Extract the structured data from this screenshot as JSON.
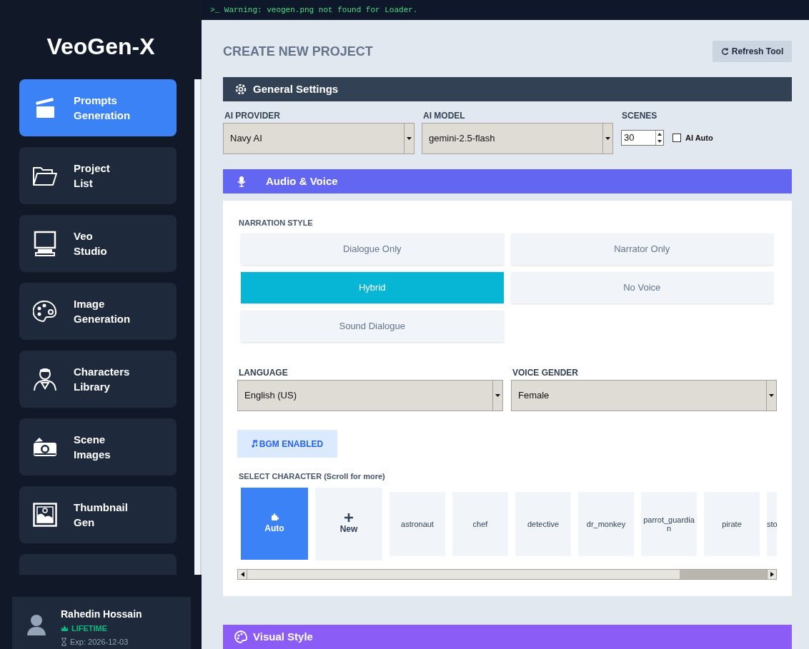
{
  "console": {
    "prompt": ">_",
    "message": "Warning: veogen.png not found for Loader."
  },
  "sidebar": {
    "title": "VeoGen-X",
    "items": [
      {
        "kind": "clapper",
        "label": "Prompts Generation",
        "selected": true
      },
      {
        "kind": "folder",
        "label": "Project List",
        "selected": false
      },
      {
        "kind": "monitor",
        "label": "Veo Studio",
        "selected": false
      },
      {
        "kind": "palette",
        "label": "Image Generation",
        "selected": false
      },
      {
        "kind": "person",
        "label": "Characters Library",
        "selected": false
      },
      {
        "kind": "camera",
        "label": "Scene Images",
        "selected": false
      },
      {
        "kind": "image",
        "label": "Thumbnail Gen",
        "selected": false
      },
      {
        "kind": "partial",
        "selected": false
      }
    ]
  },
  "user": {
    "name": "Rahedin Hossain",
    "plan": "LIFETIME",
    "expiry": "Exp: 2026-12-03"
  },
  "page": {
    "title": "CREATE NEW PROJECT",
    "refresh_button": "Refresh Tool"
  },
  "general_settings": {
    "title": "General Settings",
    "provider": {
      "label": "AI PROVIDER",
      "value": "Navy AI"
    },
    "model": {
      "label": "AI MODEL",
      "value": "gemini-2.5-flash"
    },
    "scenes": {
      "label": "SCENES",
      "value": "30"
    },
    "ai_auto": {
      "label": "AI Auto",
      "checked": false
    }
  },
  "audio_voice": {
    "title": "Audio & Voice",
    "narration_label": "NARRATION STYLE",
    "narration_options": [
      {
        "label": "Dialogue Only",
        "selected": false
      },
      {
        "label": "Narrator Only",
        "selected": false
      },
      {
        "label": "Hybrid",
        "selected": true
      },
      {
        "label": "No Voice",
        "selected": false
      },
      {
        "label": "Sound Dialogue",
        "selected": false
      }
    ],
    "language": {
      "label": "LANGUAGE",
      "value": "English (US)"
    },
    "voice_gender": {
      "label": "VOICE GENDER",
      "value": "Female"
    },
    "bgm_button": "BGM ENABLED",
    "character_label": "SELECT CHARACTER (Scroll for more)",
    "characters": [
      {
        "kind": "auto",
        "label": "Auto",
        "selected": true
      },
      {
        "kind": "new",
        "label": "New",
        "selected": false
      },
      {
        "kind": "character",
        "label": "astronaut",
        "selected": false
      },
      {
        "kind": "character",
        "label": "chef",
        "selected": false
      },
      {
        "kind": "character",
        "label": "detective",
        "selected": false
      },
      {
        "kind": "character",
        "label": "dr_monkey",
        "selected": false
      },
      {
        "kind": "character",
        "label": "parrot_guardian",
        "selected": false
      },
      {
        "kind": "character",
        "label": "pirate",
        "selected": false
      },
      {
        "kind": "cut",
        "label": "sto",
        "selected": false
      }
    ]
  },
  "visual_style": {
    "title": "Visual Style"
  }
}
